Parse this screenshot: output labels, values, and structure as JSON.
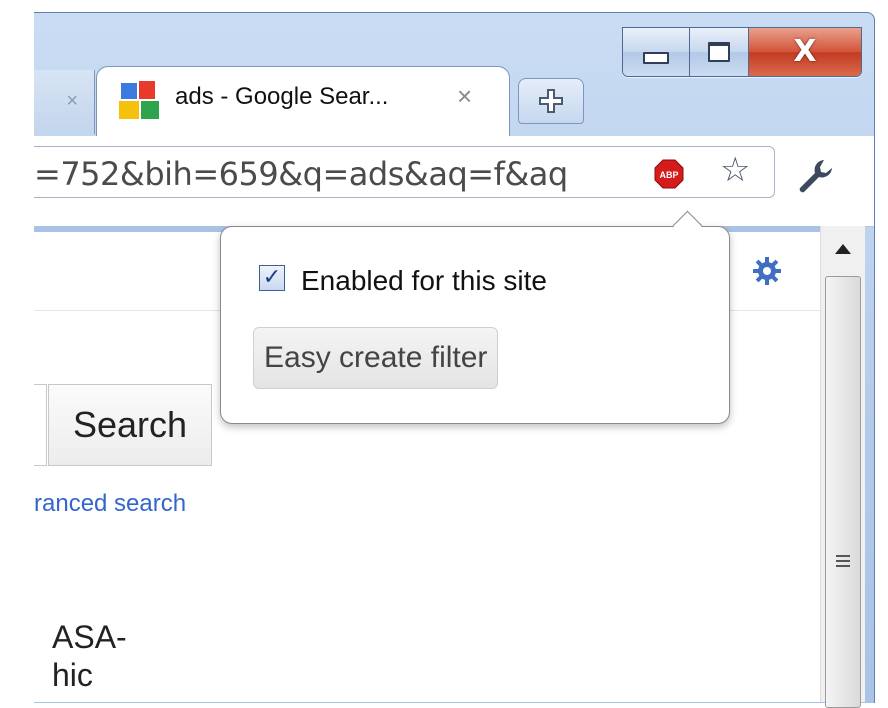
{
  "window": {
    "minimize_icon": "minimize-icon",
    "maximize_icon": "maximize-icon",
    "close_label": "X"
  },
  "tabs": {
    "inactive_close": "×",
    "active_title": "ads - Google Sear...",
    "active_close": "×",
    "new_tab_icon": "new-tab-icon"
  },
  "toolbar": {
    "url_text": "=752&bih=659&q=ads&aq=f&aq",
    "abp_label": "ABP",
    "star_glyph": "☆"
  },
  "page": {
    "search_button": "Search",
    "advanced_search": "ranced search",
    "result_line1": "ASA-",
    "result_line2": "hic"
  },
  "popup": {
    "enabled_label": "Enabled for this site",
    "enabled_checked": true,
    "easy_filter_label": "Easy create filter"
  },
  "colors": {
    "frame": "#b3cbea",
    "close_button": "#c23b22",
    "link": "#3366cc",
    "abp_red": "#d41c1c"
  }
}
